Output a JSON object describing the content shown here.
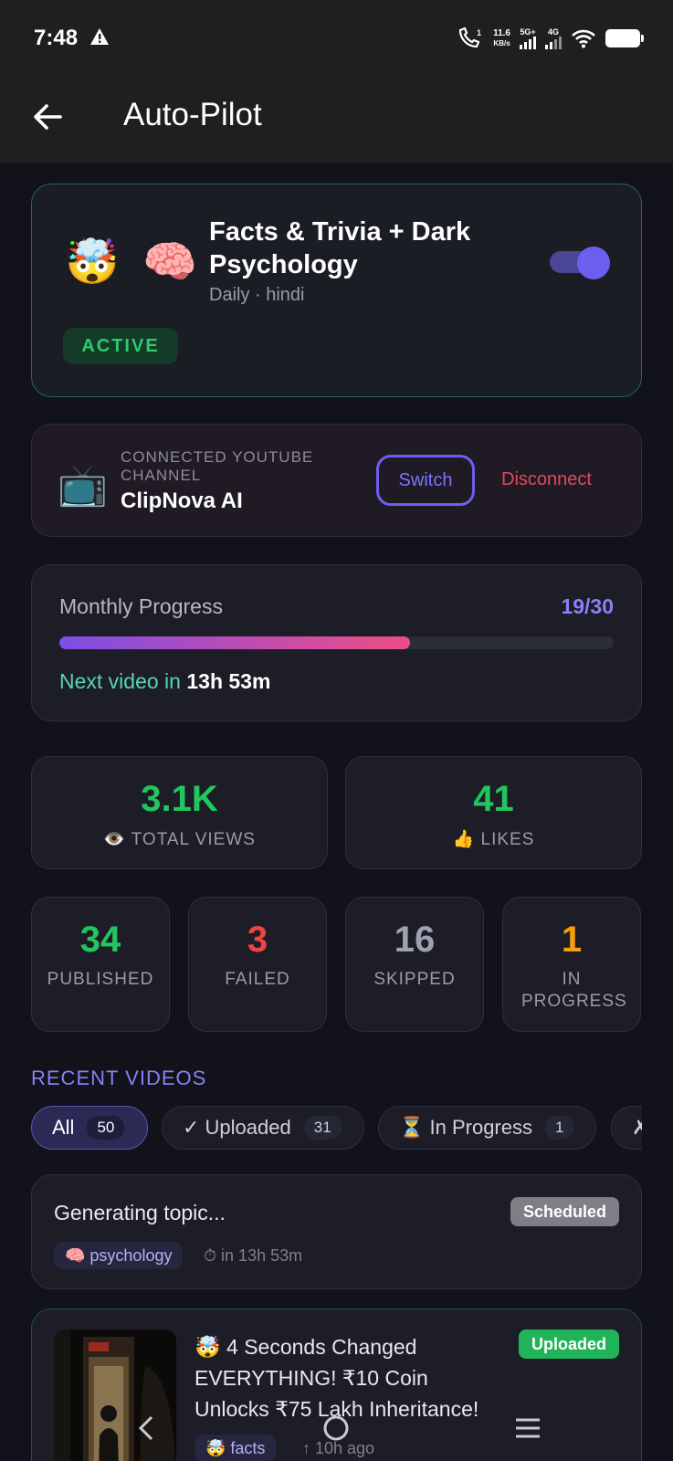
{
  "status": {
    "time": "7:48",
    "speed_value": "11.6",
    "speed_unit": "KB/s",
    "net1": "5G+",
    "net2": "4G",
    "call_sim": "1"
  },
  "appbar": {
    "title": "Auto-Pilot"
  },
  "pilot": {
    "emojis": "🤯 🧠",
    "title": "Facts & Trivia + Dark Psychology",
    "subtitle": "Daily · hindi",
    "status": "ACTIVE",
    "enabled": true
  },
  "channel": {
    "label": "CONNECTED YOUTUBE CHANNEL",
    "name": "ClipNova AI",
    "switch_label": "Switch",
    "disconnect_label": "Disconnect",
    "icon": "📺"
  },
  "progress": {
    "label": "Monthly Progress",
    "count": "19/30",
    "value": 19,
    "total": 30,
    "next_prefix": "Next video in ",
    "next_time": "13h 53m"
  },
  "stats_big": [
    {
      "value": "3.1K",
      "label": "TOTAL VIEWS",
      "icon": "👁️",
      "color": "#22c55e"
    },
    {
      "value": "41",
      "label": "LIKES",
      "icon": "👍",
      "color": "#22c55e"
    }
  ],
  "stats_small": [
    {
      "value": "34",
      "label": "PUBLISHED",
      "color": "#22c55e"
    },
    {
      "value": "3",
      "label": "FAILED",
      "color": "#ef4444"
    },
    {
      "value": "16",
      "label": "SKIPPED",
      "color": "#9ca3af"
    },
    {
      "value": "1",
      "label": "IN PROGRESS",
      "color": "#f59e0b"
    }
  ],
  "recent": {
    "title": "RECENT VIDEOS",
    "filters": [
      {
        "label": "All",
        "count": "50",
        "active": true
      },
      {
        "label": "✓ Uploaded",
        "count": "31",
        "active": false
      },
      {
        "label": "⏳ In Progress",
        "count": "1",
        "active": false
      },
      {
        "label": "✗",
        "count": "",
        "active": false
      }
    ],
    "videos": [
      {
        "title": "Generating topic...",
        "status": "Scheduled",
        "tag": "🧠 psychology",
        "meta": "⏱ in 13h 53m"
      },
      {
        "title": "🤯 4 Seconds Changed EVERYTHING! ₹10 Coin Unlocks ₹75 Lakh Inheritance!",
        "status": "Uploaded",
        "tag": "🤯 facts",
        "meta": "↑ 10h ago"
      }
    ]
  },
  "colors": {
    "accent": "#6b5ff0",
    "success": "#22c55e",
    "danger": "#e14b5c",
    "background": "#11121a"
  }
}
